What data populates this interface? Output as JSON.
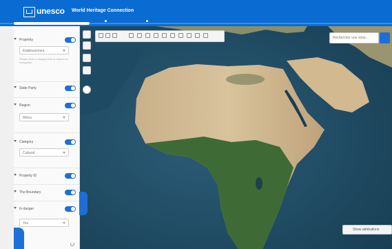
{
  "header": {
    "logo_text": "unesco",
    "app_title": "World Heritage Connection"
  },
  "sidebar": {
    "filters": [
      {
        "label": "Propriety",
        "value": "Etablissement",
        "hint": "Please click to display hers or search ici navigation"
      },
      {
        "label": "State Party"
      },
      {
        "label": "Region",
        "value": "Africa"
      },
      {
        "label": "Category",
        "value": "Cultural"
      },
      {
        "label": "Property ID"
      },
      {
        "label": "The Boundary"
      },
      {
        "label": "In danger",
        "value": "Yes"
      }
    ]
  },
  "map": {
    "search_placeholder": "Rechercher une zone...",
    "legend_button": "Show attributions"
  },
  "colors": {
    "header_blue": "#0a6cd3",
    "toggle_blue": "#1d6fd6",
    "ocean": "#1e4a63"
  }
}
